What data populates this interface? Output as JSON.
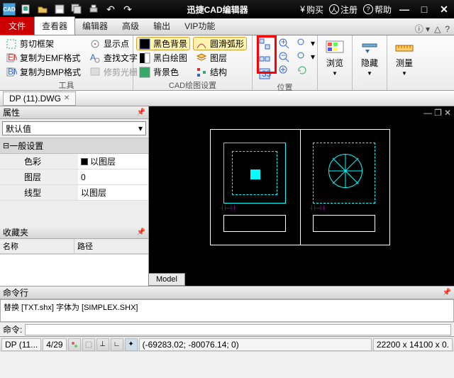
{
  "title": "迅捷CAD编辑器",
  "titlebar_right": {
    "buy": "购买",
    "register": "注册",
    "help": "帮助"
  },
  "tabs": {
    "file": "文件",
    "viewer": "查看器",
    "editor": "编辑器",
    "advanced": "高级",
    "output": "输出",
    "vip": "VIP功能"
  },
  "ribbon": {
    "tools": {
      "crop": "剪切框架",
      "copy_emf": "复制为EMF格式",
      "copy_bmp": "复制为BMP格式",
      "show_point": "显示点",
      "find_text": "查找文字",
      "edit_raster": "修剪光栅",
      "label": "工具"
    },
    "cad": {
      "black_bg": "黑色背景",
      "bw_draw": "黑白绘图",
      "bg_color": "背景色",
      "smooth_arc": "圆滑弧形",
      "layer": "图层",
      "structure": "结构",
      "label": "CAD绘图设置"
    },
    "position": {
      "label": "位置"
    },
    "browse": {
      "label": "浏览"
    },
    "hide": {
      "label": "隐藏"
    },
    "measure": {
      "label": "测量"
    }
  },
  "doc_tab": "DP (11).DWG",
  "props_panel": {
    "title": "属性",
    "default": "默认值",
    "section": "一般设置",
    "color": "色彩",
    "color_val": "以图层",
    "layer": "图层",
    "layer_val": "0",
    "linetype": "线型",
    "linetype_val": "以图层"
  },
  "fav_panel": {
    "title": "收藏夹",
    "col_name": "名称",
    "col_path": "路径"
  },
  "model_tab": "Model",
  "cmd": {
    "title": "命令行",
    "text": "替换 [TXT.shx] 字体为 [SIMPLEX.SHX]",
    "prompt": "命令:"
  },
  "status": {
    "doc": "DP (11...",
    "line": "4/29",
    "coords": "(-69283.02; -80076.14; 0)",
    "size": "22200 x 14100 x 0."
  }
}
